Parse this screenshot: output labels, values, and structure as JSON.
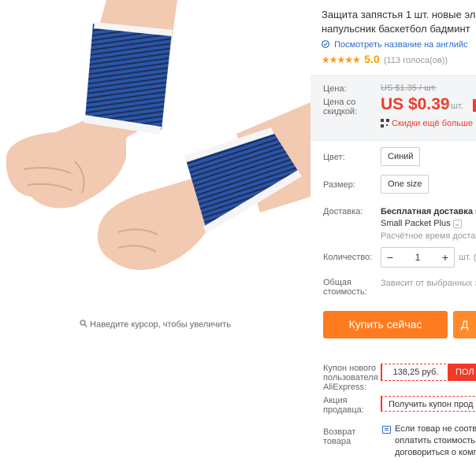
{
  "image": {
    "zoom_hint": "Наведите курсор, чтобы увеличить",
    "colors": {
      "band_blue": "#2a55a8",
      "band_dark": "#1d2e55",
      "band_trim": "#f5f5f5",
      "skin": "#f2c9b1"
    }
  },
  "product": {
    "title_line1": "Защита запястья 1 шт. новые эл",
    "title_line2": "напульсник баскетбол бадминт",
    "translate_link": "Посмотреть название на английс",
    "rating_stars": "★★★★★",
    "rating_score": "5.0",
    "votes": "(113 голоса(ов))"
  },
  "price": {
    "label": "Цена:",
    "old": "US $1.35 / шт.",
    "discount_label_1": "Цена со",
    "discount_label_2": "скидкой:",
    "new": "US $0.39",
    "per": "/ шт.",
    "app_discount": "Скидки ещё больше",
    "accent_color": "#f23a26"
  },
  "options": {
    "color_label": "Цвет:",
    "color_value": "Синий",
    "size_label": "Размер:",
    "size_value": "One size"
  },
  "shipping": {
    "label": "Доставка:",
    "title": "Бесплатная доставка в",
    "method": "Small Packet Plus",
    "estimate": "Расчётное время достав"
  },
  "quantity": {
    "label": "Количество:",
    "minus": "−",
    "value": "1",
    "plus": "+",
    "unit": "шт. (2"
  },
  "total": {
    "label_1": "Общая",
    "label_2": "стоимость:",
    "note": "Зависит от выбранных з"
  },
  "actions": {
    "buy_now": "Купить сейчас",
    "cart_partial": "Д",
    "buy_color": "#ff7b1f"
  },
  "coupon": {
    "label_1": "Купон нового",
    "label_2": "пользователя",
    "label_3": "AliExpress:",
    "amount": "138,25 руб.",
    "get": "ПОЛ"
  },
  "seller_promo": {
    "label_1": "Акция",
    "label_2": "продавца:",
    "text": "Получить купон прод"
  },
  "returns": {
    "label_1": "Возврат",
    "label_2": "товара",
    "line1": "Если товар не соотве",
    "line2": "оплатить стоимость с",
    "line3": "договориться о комп"
  }
}
